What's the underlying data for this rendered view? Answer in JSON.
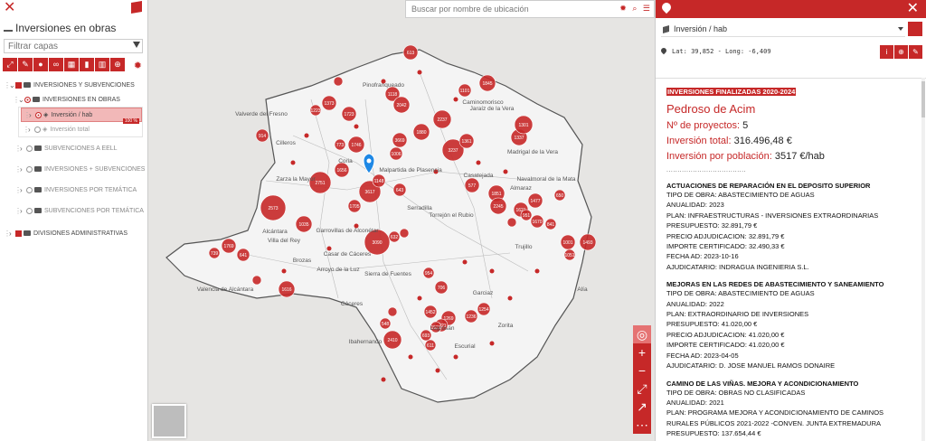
{
  "left_panel": {
    "title": "Inversiones en obras",
    "filter_placeholder": "Filtrar capas",
    "toolbar_icons": [
      "expand-icon",
      "wrench-icon",
      "paint-icon",
      "link-icon",
      "table-icon",
      "trash-icon",
      "chart-icon",
      "add-icon"
    ],
    "tree": {
      "group_main": "INVERSIONES Y SUBVENCIONES",
      "group_obras": "INVERSIONES EN OBRAS",
      "layer_hab": "Inversión / hab",
      "layer_hab_pct": "100 %",
      "layer_total": "Inversión total",
      "subv_eell": "SUBVENCIONES A EELL",
      "inv_subv": "INVERSIONES + SUBVENCIONES",
      "inv_tematica": "INVERSIONES POR TEMÁTICA",
      "subv_tematica": "SUBVENCIONES POR TEMÁTICA",
      "divisiones": "DIVISIONES ADMINISTRATIVAS"
    }
  },
  "map": {
    "search_placeholder": "Buscar por nombre de ubicación",
    "accent": "#c62828",
    "place_labels": [
      {
        "t": "Valverde del Fresno",
        "cls": "lbl"
      },
      {
        "t": "Cilleros",
        "cls": "lbl"
      },
      {
        "t": "Coria",
        "cls": "lbl"
      },
      {
        "t": "Zarza la Mayor",
        "cls": "lbl"
      },
      {
        "t": "Malpartida de Plasencia",
        "cls": "lbl"
      },
      {
        "t": "Casatejada",
        "cls": "lbl"
      },
      {
        "t": "Serradilla",
        "cls": "lbl"
      },
      {
        "t": "Torrejón el Rubio",
        "cls": "lbl"
      },
      {
        "t": "Alcántara",
        "cls": "lbl"
      },
      {
        "t": "Villa del Rey",
        "cls": "lbl"
      },
      {
        "t": "Garrovillas de Alconétar",
        "cls": "lbl"
      },
      {
        "t": "Casar de Cáceres",
        "cls": "lbl"
      },
      {
        "t": "Brozas",
        "cls": "lbl"
      },
      {
        "t": "Arroyo de la Luz",
        "cls": "lbl"
      },
      {
        "t": "Valencia de Alcántara",
        "cls": "lbl"
      },
      {
        "t": "Cáceres",
        "cls": "lbl"
      },
      {
        "t": "Trujillo",
        "cls": "lbl"
      },
      {
        "t": "Garciaz",
        "cls": "lbl"
      },
      {
        "t": "Zorita",
        "cls": "lbl"
      },
      {
        "t": "Escurial",
        "cls": "lbl"
      },
      {
        "t": "Logrosán",
        "cls": "lbl"
      },
      {
        "t": "Alía",
        "cls": "lbl"
      },
      {
        "t": "Ibahernando",
        "cls": "lbl"
      },
      {
        "t": "Caminomorisco",
        "cls": "lbl"
      },
      {
        "t": "Pinofranqueado",
        "cls": "lbl"
      },
      {
        "t": "Jaraíz de la Vera",
        "cls": "lbl"
      },
      {
        "t": "Madrigal de la Vera",
        "cls": "lbl"
      },
      {
        "t": "Navalmoral de la Mata",
        "cls": "lbl"
      },
      {
        "t": "Almaraz",
        "cls": "lbl"
      },
      {
        "t": "Sierra de Fuentes",
        "cls": "lbl"
      }
    ],
    "bubbles": [
      "1845",
      "1101",
      "613",
      "1118",
      "2042",
      "2237",
      "3237",
      "1361",
      "1337",
      "1301",
      "1746",
      "773",
      "1723",
      "1006",
      "1880",
      "3669",
      "2751",
      "1656",
      "643",
      "1705",
      "3617",
      "1148",
      "577",
      "1851",
      "2245",
      "1621",
      "1477",
      "951",
      "1670",
      "841",
      "2573",
      "1035",
      "3090",
      "632",
      "967",
      "1001",
      "1493",
      "1051",
      "739",
      "1769",
      "641",
      "1616",
      "755",
      "954",
      "706",
      "1452",
      "1269",
      "1254",
      "1236",
      "1621",
      "1521",
      "2410",
      "693",
      "611",
      "548",
      "1040",
      "1373",
      "1223",
      "1617",
      "914",
      "2573",
      "650"
    ],
    "tool_icons": [
      "locate-icon",
      "zoom-in-icon",
      "zoom-out-icon",
      "fullscreen-icon",
      "expand-icon",
      "more-icon"
    ]
  },
  "right_panel": {
    "layer_select": "Inversión / hab",
    "coords": "Lat: 39,852 - Long: -6,409",
    "section_tag": "INVERSIONES FINALIZADAS 2020-2024",
    "place": "Pedroso de Acim",
    "n_proyectos_label": "Nº de proyectos:",
    "n_proyectos": "5",
    "inv_total_label": "Inversión total:",
    "inv_total": "316.496,48 €",
    "inv_pob_label": "Inversión por población:",
    "inv_pob": "3517 €/hab",
    "separator": "....................................",
    "projects": [
      {
        "title": "ACTUACIONES DE REPARACIÓN EN EL DEPOSITO SUPERIOR",
        "lines": [
          "TIPO DE OBRA: ABASTECIMIENTO DE AGUAS",
          "ANUALIDAD: 2023",
          "PLAN: INFRAESTRUCTURAS - INVERSIONES EXTRAORDINARIAS",
          "PRESUPUESTO: 32.891,79 €",
          "PRECIO ADJUDICACION: 32.891,79 €",
          "IMPORTE CERTIFICADO: 32.490,33 €",
          "FECHA AD: 2023-10-16",
          "AJUDICATARIO: INDRAGUA INGENIERIA S.L."
        ]
      },
      {
        "title": "MEJORAS EN LAS REDES DE ABASTECIMIENTO Y SANEAMIENTO",
        "lines": [
          "TIPO DE OBRA: ABASTECIMIENTO DE AGUAS",
          "ANUALIDAD: 2022",
          "PLAN: EXTRAORDINARIO DE INVERSIONES",
          "PRESUPUESTO: 41.020,00 €",
          "PRECIO ADJUDICACION: 41.020,00 €",
          "IMPORTE CERTIFICADO: 41.020,00 €",
          "FECHA AD: 2023-04-05",
          "AJUDICATARIO: D. JOSE MANUEL RAMOS DONAIRE"
        ]
      },
      {
        "title": "CAMINO DE LAS VIÑAS. MEJORA Y ACONDICIONAMIENTO",
        "lines": [
          "TIPO DE OBRA: OBRAS NO CLASIFICADAS",
          "ANUALIDAD: 2021",
          "PLAN: PROGRAMA MEJORA Y ACONDICIONAMIENTO DE CAMINOS",
          "RURALES PÚBLICOS 2021-2022 -CONVEN. JUNTA EXTREMADURA",
          "PRESUPUESTO: 137.654,44 €"
        ]
      }
    ]
  }
}
